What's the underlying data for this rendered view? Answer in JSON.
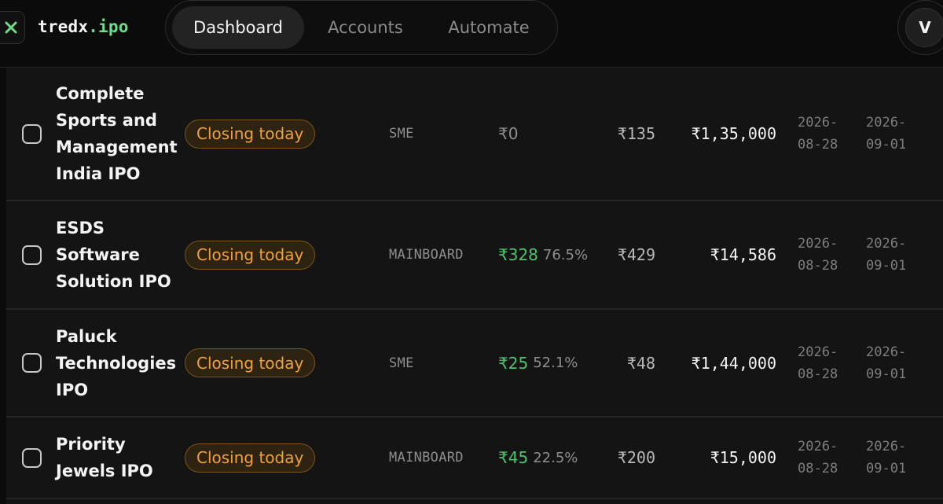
{
  "brand": {
    "name": "tredx",
    "suffix": ".ipo"
  },
  "nav": {
    "tabs": [
      {
        "label": "Dashboard"
      },
      {
        "label": "Accounts"
      },
      {
        "label": "Automate"
      }
    ]
  },
  "user": {
    "initial": "V"
  },
  "colors": {
    "accent_green": "#4cc36c",
    "status_orange": "#f0a23a",
    "background": "#0b0b0b"
  },
  "icons": {
    "logo": "x-mark-icon"
  },
  "ipos": [
    {
      "name_lines": [
        "Complete",
        "Sports and",
        "Management",
        "India IPO"
      ],
      "status": "Closing today",
      "type": "SME",
      "gmp": "₹0",
      "gmp_pct": "",
      "price": "₹135",
      "min_investment": "₹1,35,000",
      "open": [
        "2026-",
        "08-28"
      ],
      "close": [
        "2026-",
        "09-01"
      ]
    },
    {
      "name_lines": [
        "ESDS",
        "Software",
        "Solution IPO"
      ],
      "status": "Closing today",
      "type": "MAINBOARD",
      "gmp": "₹328",
      "gmp_pct": "76.5%",
      "price": "₹429",
      "min_investment": "₹14,586",
      "open": [
        "2026-",
        "08-28"
      ],
      "close": [
        "2026-",
        "09-01"
      ]
    },
    {
      "name_lines": [
        "Paluck",
        "Technologies",
        "IPO"
      ],
      "status": "Closing today",
      "type": "SME",
      "gmp": "₹25",
      "gmp_pct": "52.1%",
      "price": "₹48",
      "min_investment": "₹1,44,000",
      "open": [
        "2026-",
        "08-28"
      ],
      "close": [
        "2026-",
        "09-01"
      ]
    },
    {
      "name_lines": [
        "Priority",
        "Jewels IPO"
      ],
      "status": "Closing today",
      "type": "MAINBOARD",
      "gmp": "₹45",
      "gmp_pct": "22.5%",
      "price": "₹200",
      "min_investment": "₹15,000",
      "open": [
        "2026-",
        "08-28"
      ],
      "close": [
        "2026-",
        "09-01"
      ]
    }
  ]
}
